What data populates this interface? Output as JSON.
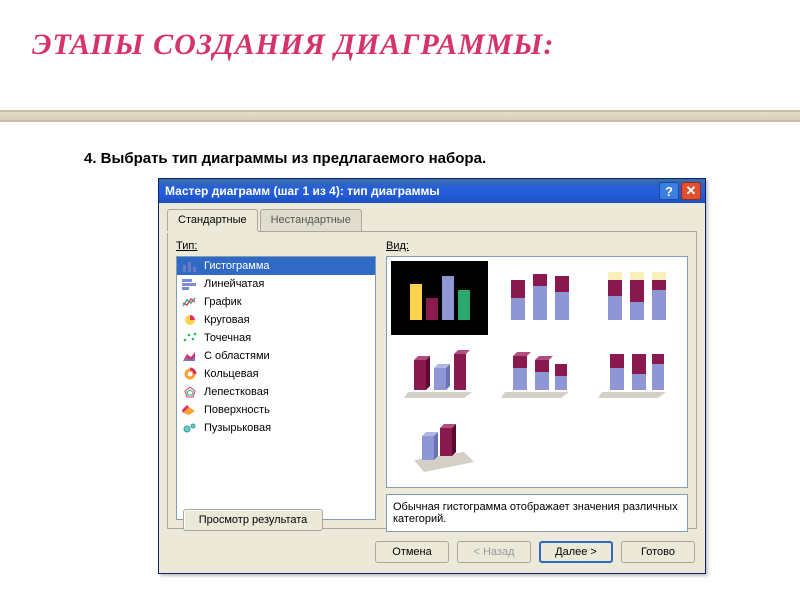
{
  "slide": {
    "title": "ЭТАПЫ СОЗДАНИЯ ДИАГРАММЫ:",
    "step": "4. Выбрать тип диаграммы из предлагаемого набора."
  },
  "wizard": {
    "title": "Мастер диаграмм (шаг 1 из 4): тип диаграммы",
    "help": "?",
    "close": "✕",
    "tabs": {
      "standard": "Стандартные",
      "nonstandard": "Нестандартные"
    },
    "labels": {
      "type": "Тип:",
      "view": "Вид:"
    },
    "types": [
      {
        "icon": "bar",
        "label": "Гистограмма",
        "selected": true
      },
      {
        "icon": "hbar",
        "label": "Линейчатая"
      },
      {
        "icon": "line",
        "label": "График"
      },
      {
        "icon": "pie",
        "label": "Круговая"
      },
      {
        "icon": "scatter",
        "label": "Точечная"
      },
      {
        "icon": "area",
        "label": "С областями"
      },
      {
        "icon": "donut",
        "label": "Кольцевая"
      },
      {
        "icon": "radar",
        "label": "Лепестковая"
      },
      {
        "icon": "surface",
        "label": "Поверхность"
      },
      {
        "icon": "bubble",
        "label": "Пузырьковая"
      }
    ],
    "description": "Обычная гистограмма отображает значения различных категорий.",
    "preview_btn": "Просмотр результата",
    "buttons": {
      "cancel": "Отмена",
      "back": "< Назад",
      "next": "Далее >",
      "finish": "Готово"
    }
  }
}
